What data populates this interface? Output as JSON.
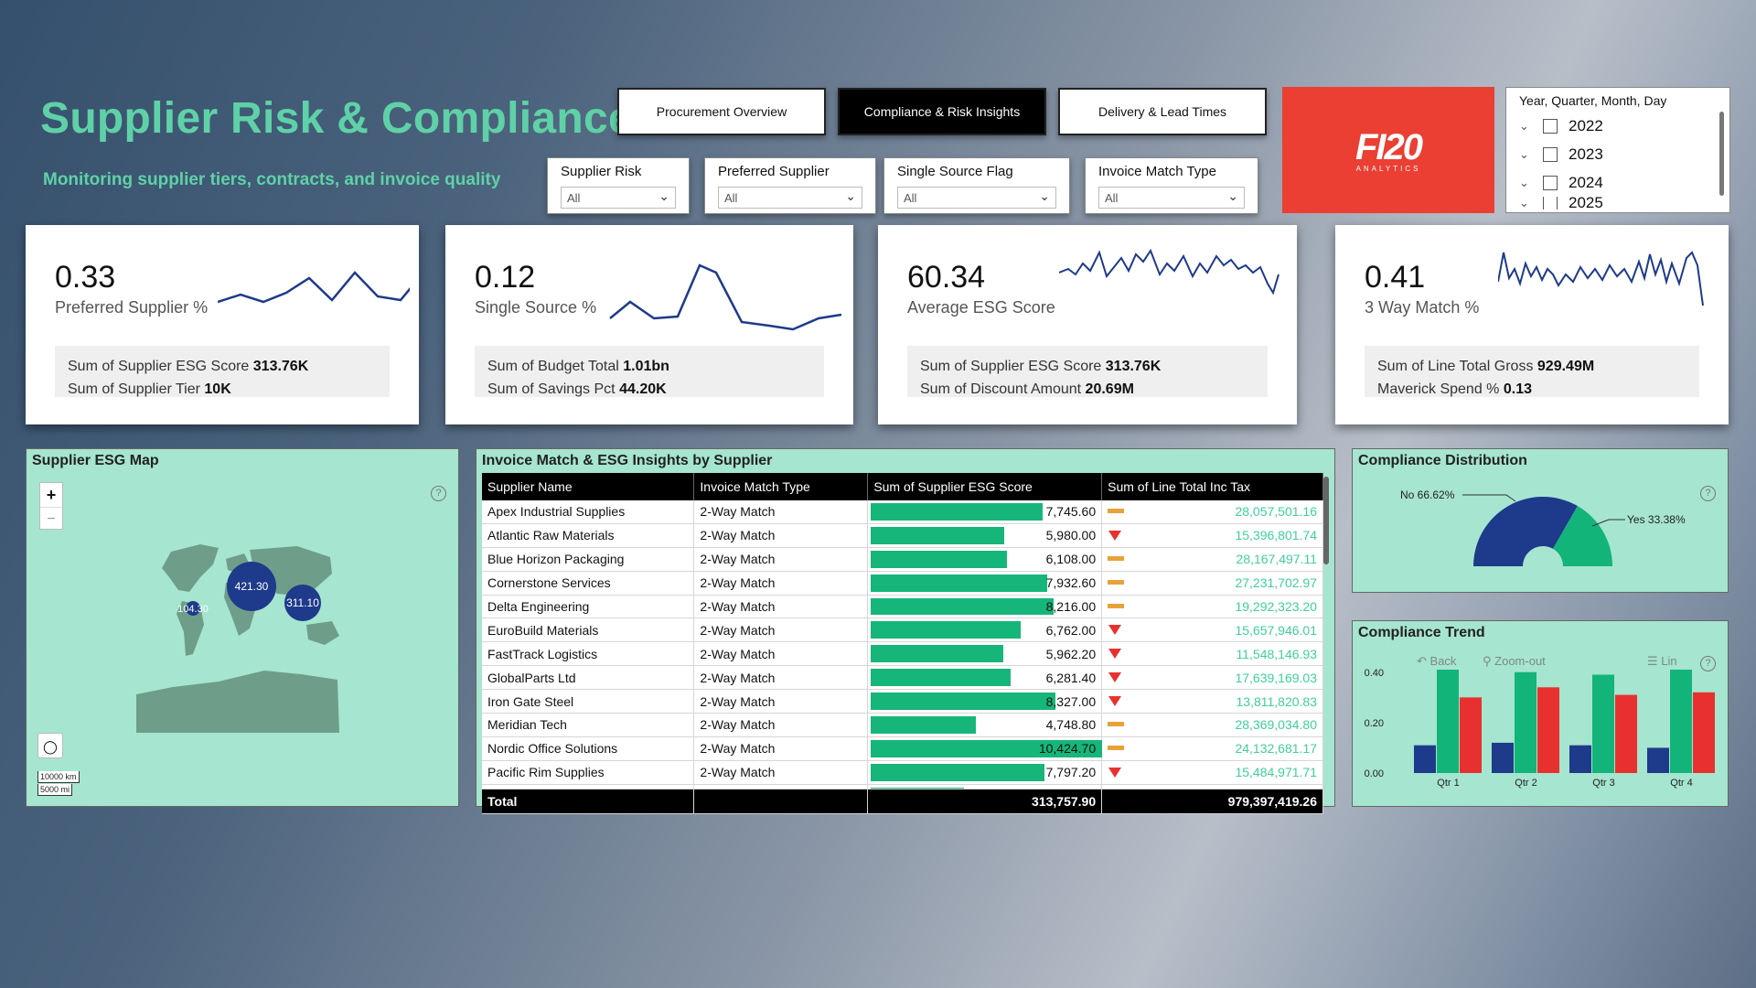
{
  "header": {
    "title": "Supplier Risk & Compliance",
    "subtitle": "Monitoring supplier tiers, contracts, and invoice quality"
  },
  "tabs": [
    {
      "label": "Procurement Overview",
      "active": false
    },
    {
      "label": "Compliance & Risk Insights",
      "active": true
    },
    {
      "label": "Delivery & Lead Times",
      "active": false
    }
  ],
  "slicers": [
    {
      "label": "Supplier Risk",
      "value": "All"
    },
    {
      "label": "Preferred Supplier",
      "value": "All"
    },
    {
      "label": "Single Source Flag",
      "value": "All"
    },
    {
      "label": "Invoice Match Type",
      "value": "All"
    }
  ],
  "logo": {
    "text": "FI20",
    "sub": "ANALYTICS",
    "color": "#eb3f33"
  },
  "date_slicer": {
    "header": "Year, Quarter, Month, Day",
    "years": [
      "2022",
      "2023",
      "2024",
      "2025"
    ]
  },
  "kpis": [
    {
      "value": "0.33",
      "caption": "Preferred Supplier %",
      "l1": "Sum of Supplier ESG Score",
      "v1": "313.76K",
      "l2": "Sum of Supplier Tier",
      "v2": "10K"
    },
    {
      "value": "0.12",
      "caption": "Single Source %",
      "l1": "Sum of Budget Total",
      "v1": "1.01bn",
      "l2": "Sum of Savings Pct",
      "v2": "44.20K"
    },
    {
      "value": "60.34",
      "caption": "Average ESG Score",
      "l1": "Sum of Supplier ESG Score",
      "v1": "313.76K",
      "l2": "Sum of Discount Amount",
      "v2": "20.69M"
    },
    {
      "value": "0.41",
      "caption": "3 Way Match %",
      "l1": "Sum of Line Total Gross",
      "v1": "929.49M",
      "l2": "Maverick Spend %",
      "v2": "0.13"
    }
  ],
  "map": {
    "title": "Supplier ESG Map",
    "zoom_in": "+",
    "zoom_out": "−",
    "bubbles": [
      {
        "label": "421.30",
        "lon": 10,
        "lat": 48,
        "value": 421.3
      },
      {
        "label": "311.10",
        "lon": 115,
        "lat": 28,
        "value": 311.1
      },
      {
        "label": "104.30",
        "lon": -78,
        "lat": 35,
        "value": 104.3
      }
    ],
    "scale_km": "10000 km",
    "scale_mi": "5000 mi"
  },
  "table": {
    "title": "Invoice Match & ESG Insights by Supplier",
    "columns": [
      "Supplier Name",
      "Invoice Match Type",
      "Sum of Supplier ESG Score",
      "Sum of Line Total Inc Tax"
    ],
    "esg_max": 10500,
    "rows": [
      {
        "name": "Apex Industrial Supplies",
        "type": "2-Way Match",
        "esg": 7745.6,
        "esg_text": "7,745.60",
        "total": "28,057,501.16",
        "icon": "flat"
      },
      {
        "name": "Atlantic Raw Materials",
        "type": "2-Way Match",
        "esg": 5980.0,
        "esg_text": "5,980.00",
        "total": "15,396,801.74",
        "icon": "down"
      },
      {
        "name": "Blue Horizon Packaging",
        "type": "2-Way Match",
        "esg": 6108.0,
        "esg_text": "6,108.00",
        "total": "28,167,497.11",
        "icon": "flat"
      },
      {
        "name": "Cornerstone Services",
        "type": "2-Way Match",
        "esg": 7932.6,
        "esg_text": "7,932.60",
        "total": "27,231,702.97",
        "icon": "flat"
      },
      {
        "name": "Delta Engineering",
        "type": "2-Way Match",
        "esg": 8216.0,
        "esg_text": "8,216.00",
        "total": "19,292,323.20",
        "icon": "flat"
      },
      {
        "name": "EuroBuild Materials",
        "type": "2-Way Match",
        "esg": 6762.0,
        "esg_text": "6,762.00",
        "total": "15,657,946.01",
        "icon": "down"
      },
      {
        "name": "FastTrack Logistics",
        "type": "2-Way Match",
        "esg": 5962.2,
        "esg_text": "5,962.20",
        "total": "11,548,146.93",
        "icon": "down"
      },
      {
        "name": "GlobalParts Ltd",
        "type": "2-Way Match",
        "esg": 6281.4,
        "esg_text": "6,281.40",
        "total": "17,639,169.03",
        "icon": "down"
      },
      {
        "name": "Iron Gate Steel",
        "type": "2-Way Match",
        "esg": 8327.0,
        "esg_text": "8,327.00",
        "total": "13,811,820.83",
        "icon": "down"
      },
      {
        "name": "Meridian Tech",
        "type": "2-Way Match",
        "esg": 4748.8,
        "esg_text": "4,748.80",
        "total": "28,369,034.80",
        "icon": "flat"
      },
      {
        "name": "Nordic Office Solutions",
        "type": "2-Way Match",
        "esg": 10424.7,
        "esg_text": "10,424.70",
        "total": "24,132,681.17",
        "icon": "flat"
      },
      {
        "name": "Pacific Rim Supplies",
        "type": "2-Way Match",
        "esg": 7797.2,
        "esg_text": "7,797.20",
        "total": "15,484,971.71",
        "icon": "down"
      }
    ],
    "total_row": {
      "label": "Total",
      "esg": "313,757.90",
      "total": "979,397,419.26"
    }
  },
  "compliance_distribution": {
    "title": "Compliance Distribution",
    "slices": [
      {
        "label": "No 66.62%",
        "value": 66.62,
        "color": "#1e3a8a"
      },
      {
        "label": "Yes 33.38%",
        "value": 33.38,
        "color": "#12b47a"
      }
    ]
  },
  "compliance_trend": {
    "title": "Compliance Trend",
    "toolbar": {
      "back": "Back",
      "zoom_out": "Zoom-out",
      "lin": "Lin"
    },
    "chart_data": {
      "type": "bar",
      "categories": [
        "Qtr 1",
        "Qtr 2",
        "Qtr 3",
        "Qtr 4"
      ],
      "series": [
        {
          "values": [
            0.11,
            0.12,
            0.11,
            0.1
          ],
          "color": "#1e3a8a"
        },
        {
          "values": [
            0.41,
            0.4,
            0.39,
            0.41
          ],
          "color": "#12b47a"
        },
        {
          "values": [
            0.3,
            0.34,
            0.31,
            0.32
          ],
          "color": "#e8312f"
        }
      ],
      "yticks": [
        "0.40",
        "0.20",
        "0.00"
      ],
      "ylim": [
        0,
        0.45
      ]
    }
  },
  "colors": {
    "accent": "#5fd1a7",
    "panel": "#a6e5cf",
    "navy": "#1e3a8a",
    "green": "#16b67b",
    "red": "#e8312f"
  }
}
